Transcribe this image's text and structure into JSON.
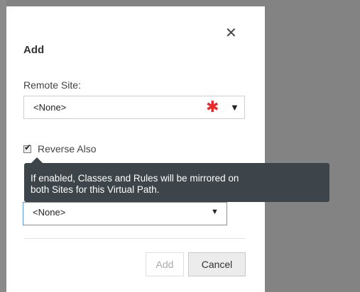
{
  "dialog": {
    "title": "Add",
    "close_icon": "close-icon"
  },
  "remote_site": {
    "label": "Remote Site:",
    "value": "<None>",
    "required": true
  },
  "reverse_also": {
    "label": "Reverse Also",
    "checked": true
  },
  "tooltip": {
    "line1": "If enabled, Classes and Rules will be mirrored on",
    "line2": "both Sites for this Virtual Path."
  },
  "second_select": {
    "value": "<None>"
  },
  "buttons": {
    "add": "Add",
    "cancel": "Cancel"
  }
}
